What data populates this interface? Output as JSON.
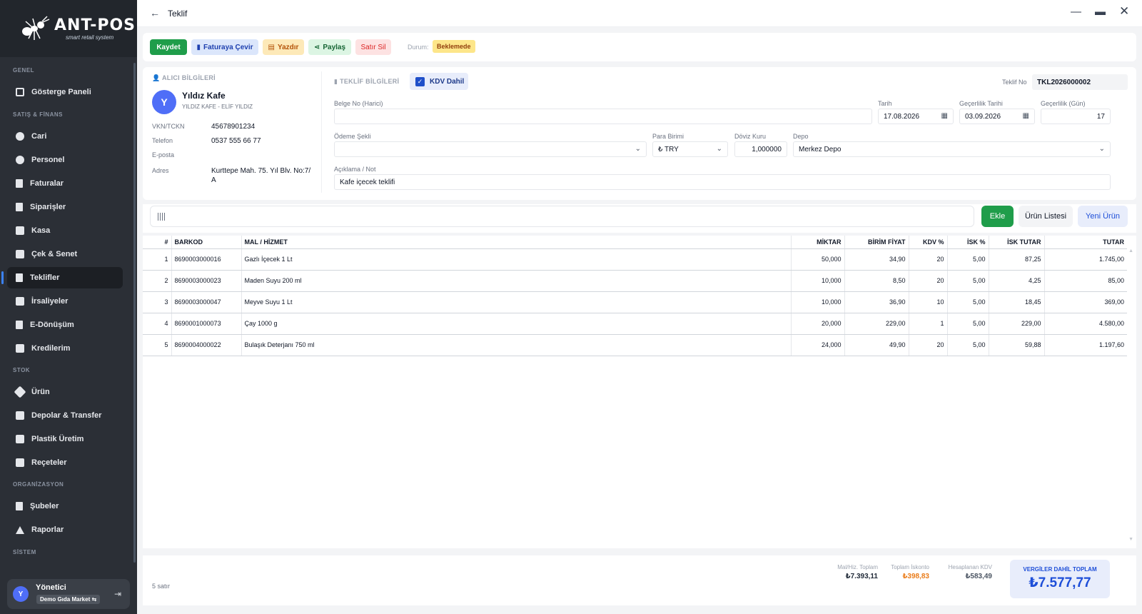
{
  "brand": {
    "title": "ANT-POS",
    "subtitle": "smart retail system"
  },
  "sidebar": {
    "sections": {
      "genel": "GENEL",
      "satis": "SATIŞ & FİNANS",
      "stok": "STOK",
      "org": "ORGANİZASYON",
      "sistem": "SİSTEM"
    },
    "items": {
      "dashboard": "Gösterge Paneli",
      "cari": "Cari",
      "personel": "Personel",
      "faturalar": "Faturalar",
      "siparisler": "Siparişler",
      "kasa": "Kasa",
      "cek": "Çek & Senet",
      "teklifler": "Teklifler",
      "irsaliyeler": "İrsaliyeler",
      "edonusum": "E-Dönüşüm",
      "kredilerim": "Kredilerim",
      "urun": "Ürün",
      "depolar": "Depolar & Transfer",
      "plastik": "Plastik Üretim",
      "receteler": "Reçeteler",
      "subeler": "Şubeler",
      "raporlar": "Raporlar"
    },
    "user": {
      "initial": "Y",
      "name": "Yönetici",
      "company": "Demo Gıda Market"
    }
  },
  "window": {
    "title": "Teklif"
  },
  "toolbar": {
    "save": "Kaydet",
    "convert": "Faturaya Çevir",
    "print": "Yazdır",
    "share": "Paylaş",
    "delete_row": "Satır Sil",
    "status_label": "Durum:",
    "status_value": "Beklemede"
  },
  "customer": {
    "header": "ALICI BİLGİLERİ",
    "initial": "Y",
    "name": "Yıldız Kafe",
    "sub": "YILDIZ KAFE - ELİF YILDIZ",
    "vkn_label": "VKN/TCKN",
    "vkn": "45678901234",
    "phone_label": "Telefon",
    "phone": "0537 555 66 77",
    "email_label": "E-posta",
    "email": "",
    "address_label": "Adres",
    "address": "Kurttepe Mah. 75. Yıl Blv. No:7/ A"
  },
  "offer": {
    "header": "TEKLİF BİLGİLERİ",
    "kdv_label": "KDV Dahil",
    "no_label": "Teklif No",
    "no": "TKL2026000002",
    "doc_label": "Belge No (Harici)",
    "doc": "",
    "date_label": "Tarih",
    "date": "17.08.2026",
    "valid_date_label": "Geçerlilik Tarihi",
    "valid_date": "03.09.2026",
    "valid_days_label": "Geçerlilik (Gün)",
    "valid_days": "17",
    "payment_label": "Ödeme Şekli",
    "payment": "",
    "currency_label": "Para Birimi",
    "currency": "₺ TRY",
    "rate_label": "Döviz Kuru",
    "rate": "1,000000",
    "warehouse_label": "Depo",
    "warehouse": "Merkez Depo",
    "note_label": "Açıklama / Not",
    "note": "Kafe içecek teklifi"
  },
  "actions": {
    "add": "Ekle",
    "product_list": "Ürün Listesi",
    "new_product": "Yeni Ürün",
    "barcode_placeholder": ""
  },
  "table": {
    "headers": [
      "#",
      "BARKOD",
      "MAL / HİZMET",
      "MİKTAR",
      "BİRİM FİYAT",
      "KDV %",
      "İSK %",
      "İSK TUTAR",
      "TUTAR"
    ],
    "rows": [
      [
        "1",
        "8690003000016",
        "Gazlı İçecek 1 Lt",
        "50,000",
        "34,90",
        "20",
        "5,00",
        "87,25",
        "1.745,00"
      ],
      [
        "2",
        "8690003000023",
        "Maden Suyu 200 ml",
        "10,000",
        "8,50",
        "20",
        "5,00",
        "4,25",
        "85,00"
      ],
      [
        "3",
        "8690003000047",
        "Meyve Suyu 1 Lt",
        "10,000",
        "36,90",
        "10",
        "5,00",
        "18,45",
        "369,00"
      ],
      [
        "4",
        "8690001000073",
        "Çay 1000 g",
        "20,000",
        "229,00",
        "1",
        "5,00",
        "229,00",
        "4.580,00"
      ],
      [
        "5",
        "8690004000022",
        "Bulaşık Deterjanı 750 ml",
        "24,000",
        "49,90",
        "20",
        "5,00",
        "59,88",
        "1.197,60"
      ]
    ]
  },
  "footer": {
    "row_count": "5 satır",
    "subtotal_label": "Mal/Hiz. Toplam",
    "subtotal": "₺7.393,11",
    "discount_label": "Toplam İskonto",
    "discount": "₺398,83",
    "tax_label": "Hesaplanan KDV",
    "tax": "₺583,49",
    "grand_label": "VERGİLER DAHİL TOPLAM",
    "grand": "₺7.577,77"
  },
  "colors": {
    "save": "#1f9d4a",
    "accent": "#1d4ed8",
    "sidebar": "#2b2f36",
    "discount": "#ea7c1a"
  }
}
